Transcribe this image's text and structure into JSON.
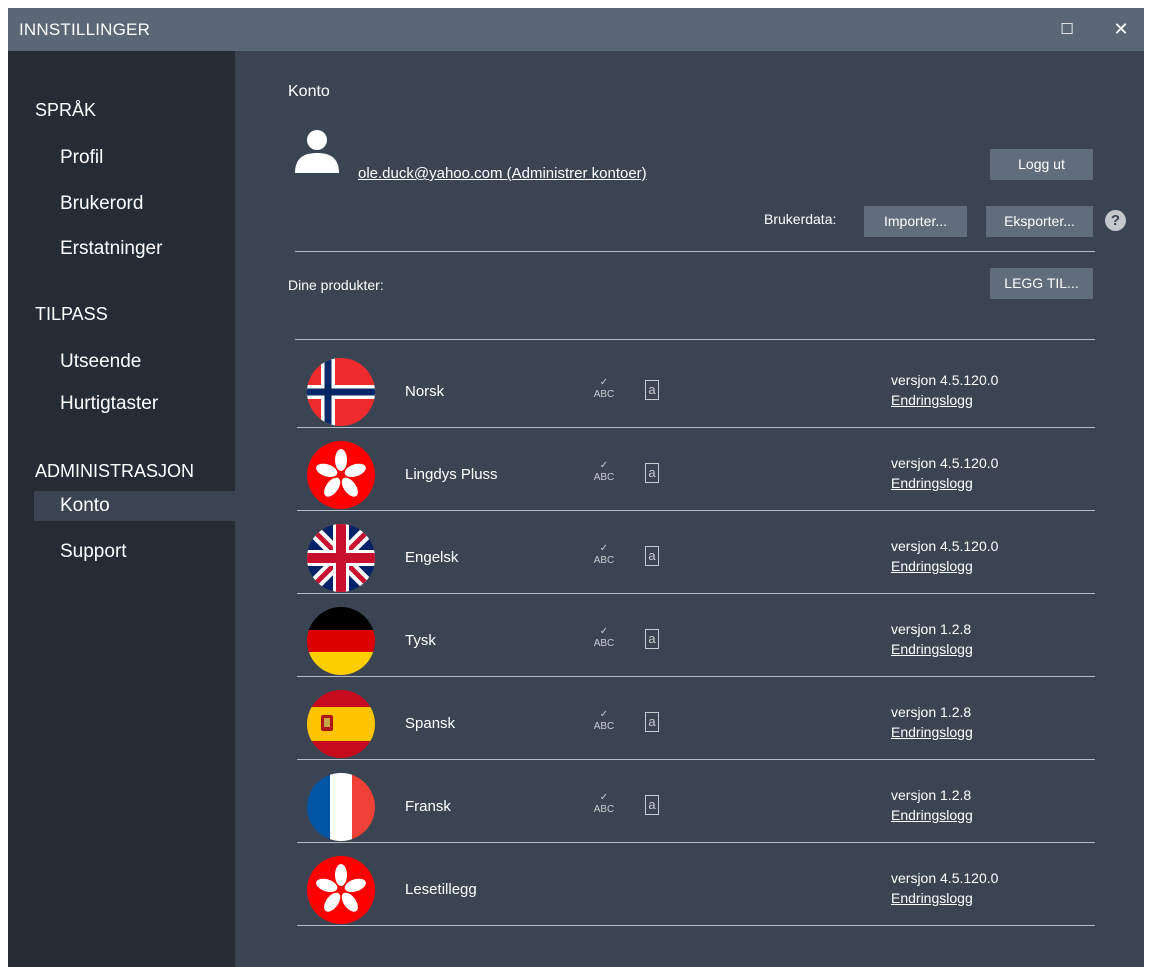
{
  "window": {
    "title": "INNSTILLINGER",
    "maximize_glyph": "☐",
    "close_glyph": "✕"
  },
  "sidebar": {
    "sections": [
      {
        "label": "SPRÅK",
        "items": [
          "Profil",
          "Brukerord",
          "Erstatninger"
        ]
      },
      {
        "label": "TILPASS",
        "items": [
          "Utseende",
          "Hurtigtaster"
        ]
      },
      {
        "label": "ADMINISTRASJON",
        "items": [
          "Konto",
          "Support"
        ]
      }
    ],
    "active_item": "Konto"
  },
  "account": {
    "heading": "Konto",
    "email_link": "ole.duck@yahoo.com (Administrer kontoer)",
    "logout": "Logg ut",
    "userdata_label": "Brukerdata:",
    "import": "Importer...",
    "export": "Eksporter...",
    "help": "?"
  },
  "products": {
    "label": "Dine produkter:",
    "add": "LEGG TIL...",
    "changelog_label": "Endringslogg",
    "items": [
      {
        "name": "Norsk",
        "version": "versjon  4.5.120.0",
        "flag": "norway",
        "icons": true
      },
      {
        "name": "Lingdys Pluss",
        "version": "versjon  4.5.120.0",
        "flag": "lingdys",
        "icons": true
      },
      {
        "name": "Engelsk",
        "version": "versjon  4.5.120.0",
        "flag": "uk",
        "icons": true
      },
      {
        "name": "Tysk",
        "version": "versjon  1.2.8",
        "flag": "germany",
        "icons": true
      },
      {
        "name": "Spansk",
        "version": "versjon  1.2.8",
        "flag": "spain",
        "icons": true
      },
      {
        "name": "Fransk",
        "version": "versjon  1.2.8",
        "flag": "france",
        "icons": true
      },
      {
        "name": "Lesetillegg",
        "version": "versjon  4.5.120.0",
        "flag": "lingdys",
        "icons": false
      }
    ]
  },
  "colors": {
    "window_bg": "#3a4452",
    "sidebar_bg": "#252c36",
    "titlebar_bg": "#596776",
    "button_bg": "#5f6d7c"
  }
}
